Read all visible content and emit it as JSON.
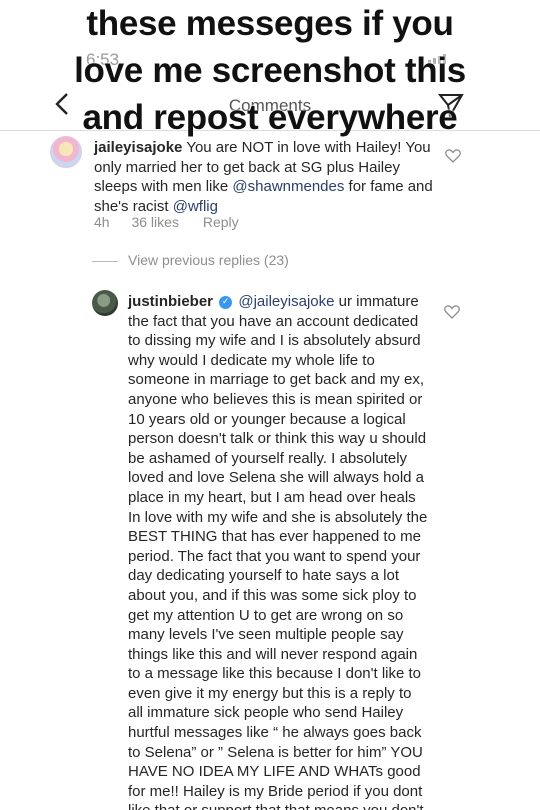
{
  "overlay": {
    "line1": "these messeges if you",
    "line2": "love me screenshot this",
    "line3": "and repost everywhere"
  },
  "status_bar": {
    "time": "6:53"
  },
  "nav": {
    "back_icon": "chevron-left-icon",
    "title": "Comments",
    "send_icon": "paper-plane-icon"
  },
  "comments": [
    {
      "username": "jaileyisajoke",
      "text_before_mention1": "You are NOT in love with Hailey! You only married her to get back at SG plus Hailey sleeps with men like",
      "mention1": "@shawnmendes",
      "text_middle": "for fame and she's racist",
      "mention2": "@wflig",
      "age": "4h",
      "likes": "36 likes",
      "reply_label": "Reply"
    },
    {
      "view_previous_label": "View previous replies (23)"
    },
    {
      "username": "justinbieber",
      "verified": true,
      "mention": "@jaileyisajoke",
      "text": "ur immature the fact that you have an account dedicated to dissing my wife and I is absolutely absurd why would I dedicate my whole life to someone in marriage to get back and my ex, anyone who believes this is mean spirited or 10 years old or younger because a logical person doesn't talk or think this way u should be ashamed of yourself really.  I absolutely loved and love Selena she will always hold a place in my heart, but I am head over heals In love with my wife and she is absolutely the BEST THING that has ever happened to me period. The fact that you want to spend your day dedicating yourself to hate says a lot about you, and if this was some sick ploy to get my attention U to get are wrong on so many levels I've seen multiple people say things like this and will never respond again to a message like this because I don't like to even give it my energy but this is a reply to all immature sick people who send Hailey hurtful messages like “ he always goes back to Selena” or ” Selena is better for him” YOU HAVE NO IDEA MY LIFE AND WHATs good for me!! Hailey is my Bride period if you dont like that or support that that means you don't"
    }
  ],
  "colors": {
    "mention": "#2a3f6a",
    "meta_gray": "#8e8e8e",
    "verified_blue": "#3897f0"
  }
}
